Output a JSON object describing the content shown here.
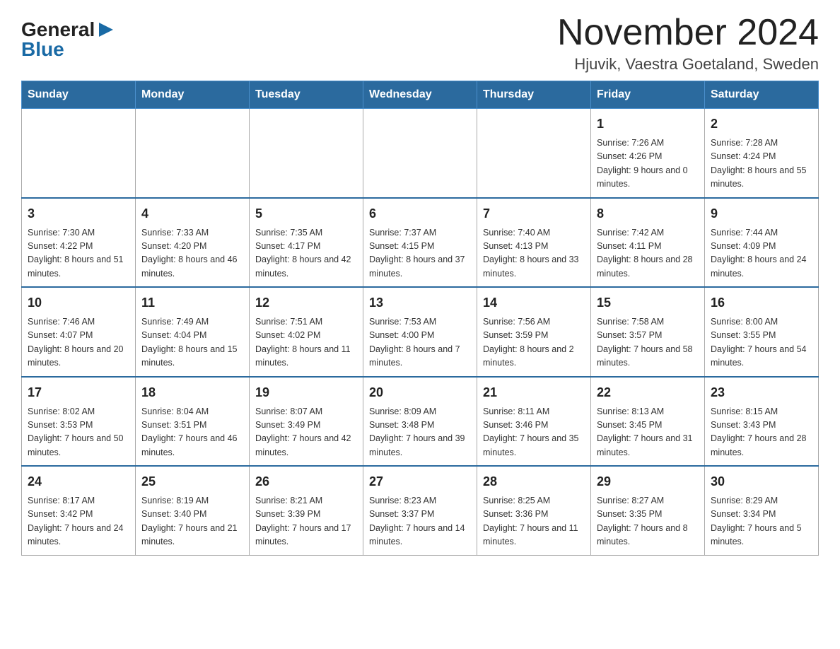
{
  "logo": {
    "general": "General",
    "blue": "Blue"
  },
  "header": {
    "month_title": "November 2024",
    "location": "Hjuvik, Vaestra Goetaland, Sweden"
  },
  "weekdays": [
    "Sunday",
    "Monday",
    "Tuesday",
    "Wednesday",
    "Thursday",
    "Friday",
    "Saturday"
  ],
  "weeks": [
    [
      {
        "day": "",
        "sunrise": "",
        "sunset": "",
        "daylight": ""
      },
      {
        "day": "",
        "sunrise": "",
        "sunset": "",
        "daylight": ""
      },
      {
        "day": "",
        "sunrise": "",
        "sunset": "",
        "daylight": ""
      },
      {
        "day": "",
        "sunrise": "",
        "sunset": "",
        "daylight": ""
      },
      {
        "day": "",
        "sunrise": "",
        "sunset": "",
        "daylight": ""
      },
      {
        "day": "1",
        "sunrise": "Sunrise: 7:26 AM",
        "sunset": "Sunset: 4:26 PM",
        "daylight": "Daylight: 9 hours and 0 minutes."
      },
      {
        "day": "2",
        "sunrise": "Sunrise: 7:28 AM",
        "sunset": "Sunset: 4:24 PM",
        "daylight": "Daylight: 8 hours and 55 minutes."
      }
    ],
    [
      {
        "day": "3",
        "sunrise": "Sunrise: 7:30 AM",
        "sunset": "Sunset: 4:22 PM",
        "daylight": "Daylight: 8 hours and 51 minutes."
      },
      {
        "day": "4",
        "sunrise": "Sunrise: 7:33 AM",
        "sunset": "Sunset: 4:20 PM",
        "daylight": "Daylight: 8 hours and 46 minutes."
      },
      {
        "day": "5",
        "sunrise": "Sunrise: 7:35 AM",
        "sunset": "Sunset: 4:17 PM",
        "daylight": "Daylight: 8 hours and 42 minutes."
      },
      {
        "day": "6",
        "sunrise": "Sunrise: 7:37 AM",
        "sunset": "Sunset: 4:15 PM",
        "daylight": "Daylight: 8 hours and 37 minutes."
      },
      {
        "day": "7",
        "sunrise": "Sunrise: 7:40 AM",
        "sunset": "Sunset: 4:13 PM",
        "daylight": "Daylight: 8 hours and 33 minutes."
      },
      {
        "day": "8",
        "sunrise": "Sunrise: 7:42 AM",
        "sunset": "Sunset: 4:11 PM",
        "daylight": "Daylight: 8 hours and 28 minutes."
      },
      {
        "day": "9",
        "sunrise": "Sunrise: 7:44 AM",
        "sunset": "Sunset: 4:09 PM",
        "daylight": "Daylight: 8 hours and 24 minutes."
      }
    ],
    [
      {
        "day": "10",
        "sunrise": "Sunrise: 7:46 AM",
        "sunset": "Sunset: 4:07 PM",
        "daylight": "Daylight: 8 hours and 20 minutes."
      },
      {
        "day": "11",
        "sunrise": "Sunrise: 7:49 AM",
        "sunset": "Sunset: 4:04 PM",
        "daylight": "Daylight: 8 hours and 15 minutes."
      },
      {
        "day": "12",
        "sunrise": "Sunrise: 7:51 AM",
        "sunset": "Sunset: 4:02 PM",
        "daylight": "Daylight: 8 hours and 11 minutes."
      },
      {
        "day": "13",
        "sunrise": "Sunrise: 7:53 AM",
        "sunset": "Sunset: 4:00 PM",
        "daylight": "Daylight: 8 hours and 7 minutes."
      },
      {
        "day": "14",
        "sunrise": "Sunrise: 7:56 AM",
        "sunset": "Sunset: 3:59 PM",
        "daylight": "Daylight: 8 hours and 2 minutes."
      },
      {
        "day": "15",
        "sunrise": "Sunrise: 7:58 AM",
        "sunset": "Sunset: 3:57 PM",
        "daylight": "Daylight: 7 hours and 58 minutes."
      },
      {
        "day": "16",
        "sunrise": "Sunrise: 8:00 AM",
        "sunset": "Sunset: 3:55 PM",
        "daylight": "Daylight: 7 hours and 54 minutes."
      }
    ],
    [
      {
        "day": "17",
        "sunrise": "Sunrise: 8:02 AM",
        "sunset": "Sunset: 3:53 PM",
        "daylight": "Daylight: 7 hours and 50 minutes."
      },
      {
        "day": "18",
        "sunrise": "Sunrise: 8:04 AM",
        "sunset": "Sunset: 3:51 PM",
        "daylight": "Daylight: 7 hours and 46 minutes."
      },
      {
        "day": "19",
        "sunrise": "Sunrise: 8:07 AM",
        "sunset": "Sunset: 3:49 PM",
        "daylight": "Daylight: 7 hours and 42 minutes."
      },
      {
        "day": "20",
        "sunrise": "Sunrise: 8:09 AM",
        "sunset": "Sunset: 3:48 PM",
        "daylight": "Daylight: 7 hours and 39 minutes."
      },
      {
        "day": "21",
        "sunrise": "Sunrise: 8:11 AM",
        "sunset": "Sunset: 3:46 PM",
        "daylight": "Daylight: 7 hours and 35 minutes."
      },
      {
        "day": "22",
        "sunrise": "Sunrise: 8:13 AM",
        "sunset": "Sunset: 3:45 PM",
        "daylight": "Daylight: 7 hours and 31 minutes."
      },
      {
        "day": "23",
        "sunrise": "Sunrise: 8:15 AM",
        "sunset": "Sunset: 3:43 PM",
        "daylight": "Daylight: 7 hours and 28 minutes."
      }
    ],
    [
      {
        "day": "24",
        "sunrise": "Sunrise: 8:17 AM",
        "sunset": "Sunset: 3:42 PM",
        "daylight": "Daylight: 7 hours and 24 minutes."
      },
      {
        "day": "25",
        "sunrise": "Sunrise: 8:19 AM",
        "sunset": "Sunset: 3:40 PM",
        "daylight": "Daylight: 7 hours and 21 minutes."
      },
      {
        "day": "26",
        "sunrise": "Sunrise: 8:21 AM",
        "sunset": "Sunset: 3:39 PM",
        "daylight": "Daylight: 7 hours and 17 minutes."
      },
      {
        "day": "27",
        "sunrise": "Sunrise: 8:23 AM",
        "sunset": "Sunset: 3:37 PM",
        "daylight": "Daylight: 7 hours and 14 minutes."
      },
      {
        "day": "28",
        "sunrise": "Sunrise: 8:25 AM",
        "sunset": "Sunset: 3:36 PM",
        "daylight": "Daylight: 7 hours and 11 minutes."
      },
      {
        "day": "29",
        "sunrise": "Sunrise: 8:27 AM",
        "sunset": "Sunset: 3:35 PM",
        "daylight": "Daylight: 7 hours and 8 minutes."
      },
      {
        "day": "30",
        "sunrise": "Sunrise: 8:29 AM",
        "sunset": "Sunset: 3:34 PM",
        "daylight": "Daylight: 7 hours and 5 minutes."
      }
    ]
  ]
}
